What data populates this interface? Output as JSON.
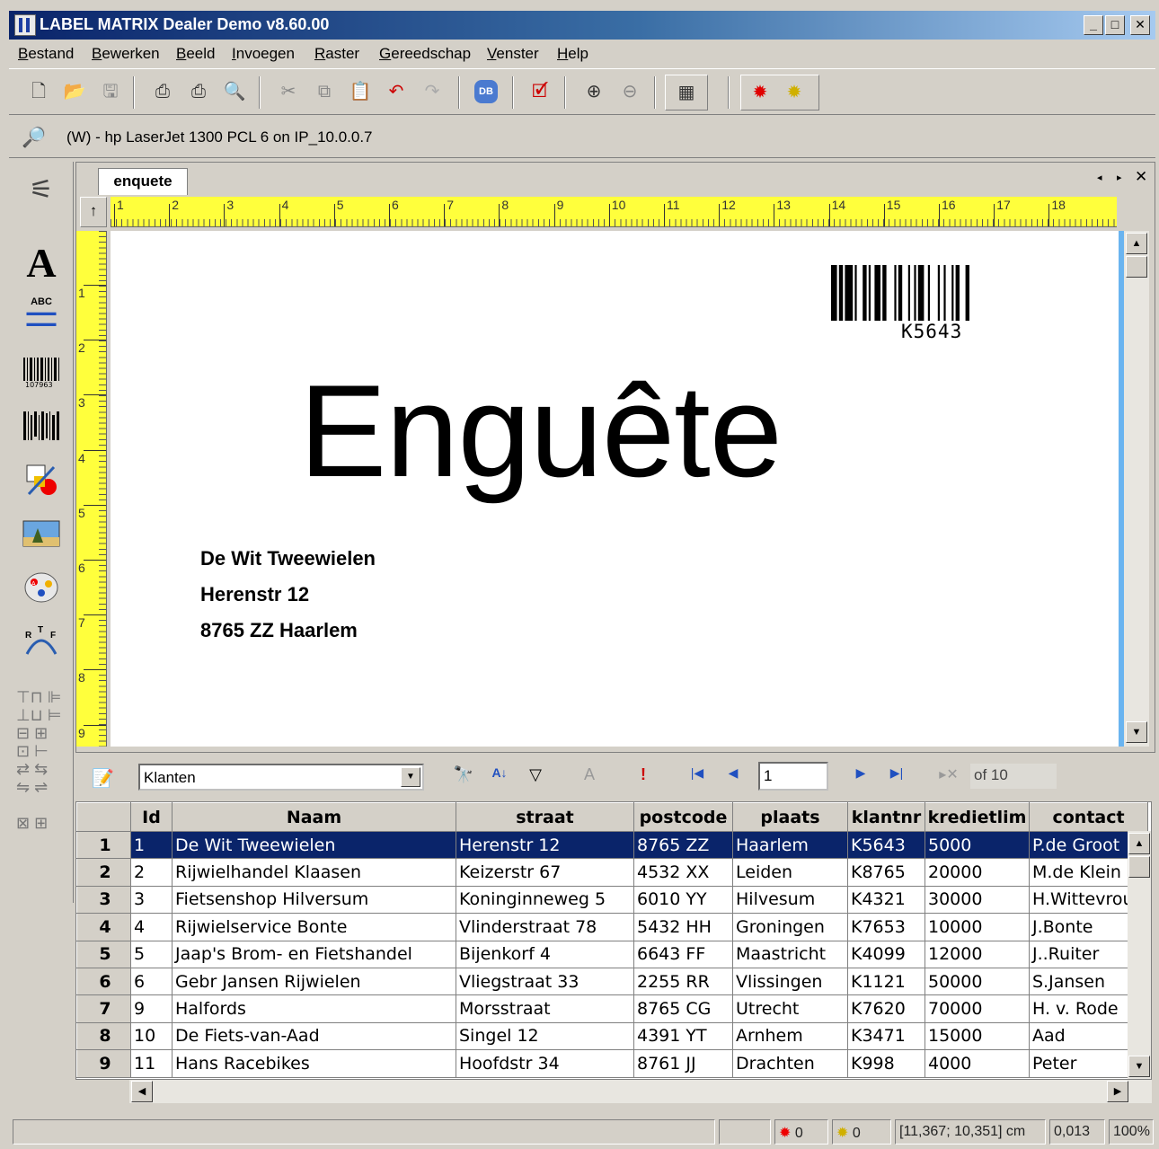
{
  "window": {
    "title": "LABEL MATRIX Dealer Demo v8.60.00",
    "controls": [
      "minimize",
      "maximize",
      "close"
    ]
  },
  "menu": [
    "Bestand",
    "Bewerken",
    "Beeld",
    "Invoegen",
    "Raster",
    "Gereedschap",
    "Venster",
    "Help"
  ],
  "toolbar": {
    "icons": [
      "new-icon",
      "open-icon",
      "save-icon",
      "print-icon",
      "print-setup-icon",
      "print-preview-icon",
      "cut-icon",
      "copy-icon",
      "paste-icon",
      "undo-icon",
      "redo-icon",
      "database-icon",
      "properties-icon",
      "zoom-in-icon",
      "zoom-out-icon",
      "grid-icon",
      "sun-red-icon",
      "sun-yellow-icon"
    ]
  },
  "printer": {
    "label": "(W) - hp LaserJet 1300 PCL 6 on IP_10.0.0.7"
  },
  "tools": [
    "wand-icon",
    "text-icon",
    "paragraph-icon",
    "barcode-icon",
    "2d-barcode-icon",
    "shapes-icon",
    "picture-icon",
    "palette-icon",
    "rtf-icon"
  ],
  "document": {
    "tab": "enquete",
    "hruler_numbers": [
      "1",
      "2",
      "3",
      "4",
      "5",
      "6",
      "7",
      "8",
      "9",
      "10",
      "11",
      "12",
      "13",
      "14",
      "15",
      "16",
      "17",
      "18"
    ],
    "vruler_numbers": [
      "1",
      "2",
      "3",
      "4",
      "5",
      "6",
      "7",
      "8",
      "9"
    ],
    "barcode_text": "K5643",
    "heading": "Enguête",
    "address": [
      "De Wit Tweewielen",
      "Herenstr 12",
      "8765 ZZ  Haarlem"
    ]
  },
  "data": {
    "source": "Klanten",
    "record": "1",
    "of_text": "of 10",
    "columns": [
      "Id",
      "Naam",
      "straat",
      "postcode",
      "plaats",
      "klantnr",
      "kredietlim",
      "contact"
    ],
    "rows": [
      {
        "n": "1",
        "cells": [
          "1",
          "De Wit Tweewielen",
          "Herenstr 12",
          "8765 ZZ",
          "Haarlem",
          "K5643",
          "5000",
          "P.de Groot"
        ]
      },
      {
        "n": "2",
        "cells": [
          "2",
          "Rijwielhandel Klaasen",
          "Keizerstr 67",
          "4532 XX",
          "Leiden",
          "K8765",
          "20000",
          "M.de Klein"
        ]
      },
      {
        "n": "3",
        "cells": [
          "3",
          "Fietsenshop Hilversum",
          "Koninginneweg 5",
          "6010 YY",
          "Hilvesum",
          "K4321",
          "30000",
          "H.Wittevrouw"
        ]
      },
      {
        "n": "4",
        "cells": [
          "4",
          "Rijwielservice Bonte",
          "Vlinderstraat 78",
          "5432 HH",
          "Groningen",
          "K7653",
          "10000",
          "J.Bonte"
        ]
      },
      {
        "n": "5",
        "cells": [
          "5",
          "Jaap's Brom- en Fietshandel",
          "Bijenkorf 4",
          "6643 FF",
          "Maastricht",
          "K4099",
          "12000",
          "J..Ruiter"
        ]
      },
      {
        "n": "6",
        "cells": [
          "6",
          "Gebr Jansen Rijwielen",
          "Vliegstraat 33",
          "2255 RR",
          "Vlissingen",
          "K1121",
          "50000",
          "S.Jansen"
        ]
      },
      {
        "n": "7",
        "cells": [
          "9",
          "Halfords",
          "Morsstraat",
          "8765 CG",
          "Utrecht",
          "K7620",
          "70000",
          "H. v. Rode"
        ]
      },
      {
        "n": "8",
        "cells": [
          "10",
          "De Fiets-van-Aad",
          "Singel 12",
          "4391 YT",
          "Arnhem",
          "K3471",
          "15000",
          "Aad"
        ]
      },
      {
        "n": "9",
        "cells": [
          "11",
          "Hans Racebikes",
          "Hoofdstr 34",
          "8761 JJ",
          "Drachten",
          "K998",
          "4000",
          "Peter"
        ]
      }
    ]
  },
  "status": {
    "red_count": "0",
    "yellow_count": "0",
    "coords": "[11,367; 10,351] cm",
    "value": "0,013",
    "zoom": "100%"
  },
  "colors": {
    "title_start": "#0a246a",
    "title_end": "#a6caf0",
    "ruler": "#ffff3c",
    "selection": "#0a246a"
  }
}
